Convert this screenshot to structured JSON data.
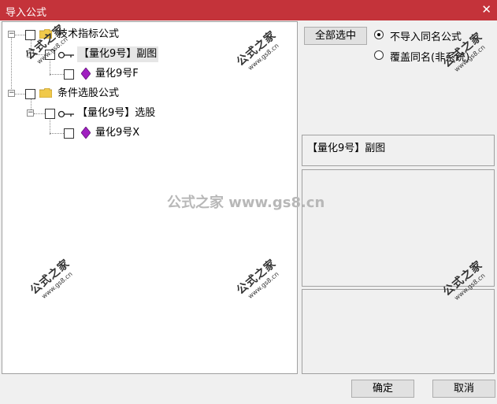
{
  "window": {
    "title": "导入公式",
    "close_glyph": "✕"
  },
  "tree": {
    "nodes": [
      {
        "label": "技术指标公式"
      },
      {
        "label": "【量化9号】副图"
      },
      {
        "label": "量化9号F"
      },
      {
        "label": "条件选股公式"
      },
      {
        "label": "【量化9号】选股"
      },
      {
        "label": "量化9号X"
      }
    ]
  },
  "buttons": {
    "select_all": "全部选中",
    "ok": "确定",
    "cancel": "取消"
  },
  "options": [
    {
      "label": "不导入同名公式",
      "selected": true
    },
    {
      "label": "覆盖同名(非系统)",
      "selected": false
    }
  ],
  "preview": {
    "name": "【量化9号】副图"
  },
  "watermark": {
    "text": "公式之家 www.gs8.cn",
    "stamp_cn": "公式之家",
    "stamp_url": "www.gs8.cn"
  },
  "icons": [
    "folder-icon",
    "key-icon",
    "gem-icon"
  ],
  "colors": {
    "titlebar": "#c4333a",
    "gem": "#a020c0",
    "folder": "#f0c94a"
  }
}
